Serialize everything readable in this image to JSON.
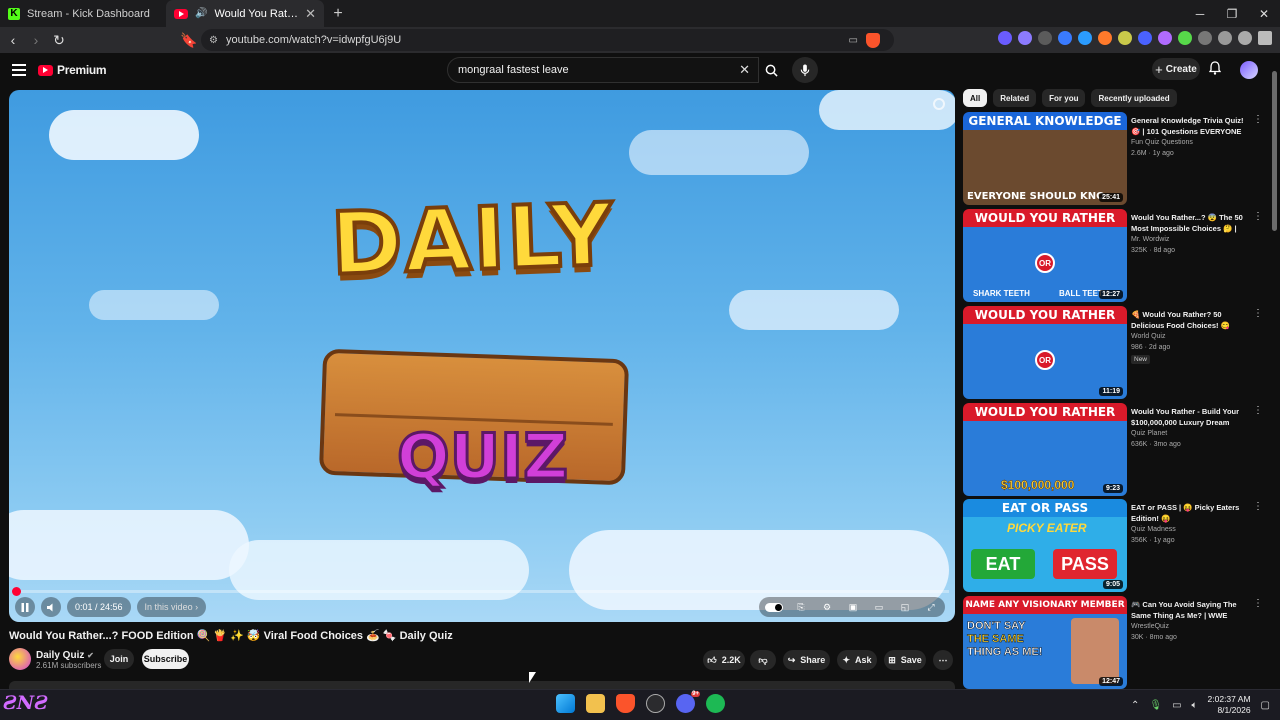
{
  "browser": {
    "tabs": [
      {
        "label": "Stream - Kick Dashboard",
        "active": false
      },
      {
        "label": "Would You Rather...? FOOD Edition",
        "active": true
      }
    ],
    "url": "youtube.com/watch?v=idwpfgU6j9U"
  },
  "youtube": {
    "logo_text": "Premium",
    "search_value": "mongraal fastest leave",
    "create_label": "Create"
  },
  "player": {
    "title_word_1": "DAILY",
    "title_word_2": "QUIZ",
    "progress_fraction": 0.0007,
    "time_display": "0:01 / 24:56",
    "chapter_label": "In this video ›"
  },
  "video": {
    "title": "Would You Rather...? FOOD Edition 🍭 🍟 ✨ 🤯 Viral Food Choices 🍝 🍬 Daily Quiz",
    "channel": "Daily Quiz",
    "subscribers": "2.61M subscribers",
    "join_label": "Join",
    "subscribe_label": "Subscribe",
    "likes": "2.2K",
    "share_label": "Share",
    "ask_label": "Ask",
    "save_label": "Save"
  },
  "sidebar": {
    "chips": [
      "All",
      "Related",
      "For you",
      "Recently uploaded"
    ],
    "recommendations": [
      {
        "thumb_text": "GENERAL KNOWLEDGE",
        "band_color": "#1a66d9",
        "body_color": "#6b4a2f",
        "duration": "25:41",
        "title": "General Knowledge Trivia Quiz! 🎯 | 101 Questions EVERYONE Shoul...",
        "channel": "Fun Quiz Questions",
        "meta": "2.6M · 1y ago",
        "badge": ""
      },
      {
        "thumb_text": "WOULD YOU RATHER",
        "band_color": "#d91a2a",
        "body_color": "#2a7cd9",
        "duration": "12:27",
        "title": "Would You Rather...? 😨 The 50 Most Impossible Choices 🤔 | MR...",
        "channel": "Mr. Wordwiz",
        "meta": "325K · 8d ago",
        "badge": ""
      },
      {
        "thumb_text": "WOULD YOU RATHER",
        "band_color": "#d91a2a",
        "body_color": "#2a7cd9",
        "duration": "11:19",
        "title": "🍕 Would You Rather? 50 Delicious Food Choices! 😋 (Only...",
        "channel": "World Quiz",
        "meta": "986 · 2d ago",
        "badge": "New"
      },
      {
        "thumb_text": "WOULD YOU RATHER",
        "band_color": "#d91a2a",
        "body_color": "#2a7cd9",
        "duration": "9:23",
        "title": "Would You Rather - Build Your $100,000,000 Luxury Dream Hou...",
        "channel": "Quiz Planet",
        "meta": "636K · 3mo ago",
        "badge": ""
      },
      {
        "thumb_text": "EAT OR PASS",
        "band_color": "#1a8be0",
        "body_color": "#2faee8",
        "duration": "9:05",
        "title": "EAT or PASS | 😝 Picky Eaters Edition! 😝",
        "channel": "Quiz Madness",
        "meta": "356K · 1y ago",
        "badge": ""
      },
      {
        "thumb_text": "NAME ANY VISIONARY MEMBER",
        "band_color": "#d91a2a",
        "body_color": "#2a7cd9",
        "duration": "12:47",
        "title": "🎮 Can You Avoid Saying The Same Thing As Me? | WWE Editio...",
        "channel": "WrestleQuiz",
        "meta": "30K · 8mo ago",
        "badge": ""
      }
    ],
    "thumb_extra": {
      "t1_bottom": "EVERYONE SHOULD KNO",
      "t2_left": "SHARK TEETH",
      "t2_right": "BALL TEETH",
      "t4_money": "$100,000,000",
      "t5_sub": "PICKY EATER",
      "t5_eat": "EAT",
      "t5_pass": "PASS",
      "t6_line1": "DON'T SAY",
      "t6_line2": "THE SAME",
      "t6_line3": "THING AS ME!"
    }
  },
  "taskbar": {
    "clock_time": "2:02:37 AM",
    "clock_date": "8/1/2026",
    "discord_badge": "9+"
  },
  "colors": {
    "accent": "#ff0033",
    "background": "#0f0f0f",
    "surface": "#272727"
  }
}
